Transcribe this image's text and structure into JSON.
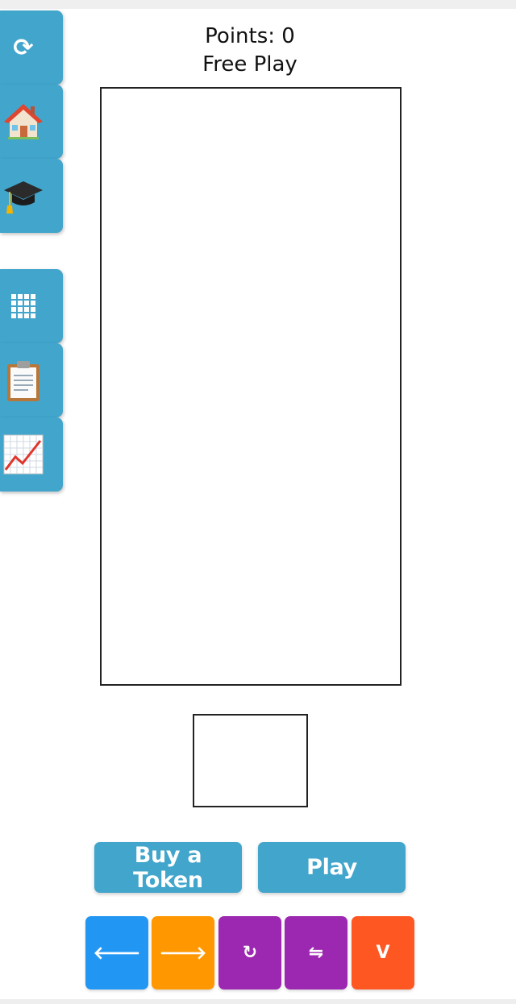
{
  "header": {
    "points_label": "Points: 0",
    "mode_label": "Free Play"
  },
  "sidebar": {
    "items": [
      {
        "name": "refresh",
        "icon": "refresh-icon",
        "glyph": "⟳"
      },
      {
        "name": "home",
        "icon": "house-icon"
      },
      {
        "name": "tutorial",
        "icon": "graduation-cap-icon"
      },
      {
        "name": "grid",
        "icon": "grid-icon"
      },
      {
        "name": "clipboard",
        "icon": "clipboard-icon"
      },
      {
        "name": "chart",
        "icon": "chart-increasing-icon"
      }
    ],
    "color": "#41a5cc"
  },
  "actions": {
    "buy_token_label": "Buy a Token",
    "play_label": "Play"
  },
  "controls": [
    {
      "name": "move-left",
      "glyph": "🡐",
      "color": "#2196f3"
    },
    {
      "name": "move-right",
      "glyph": "🡒",
      "color": "#ff9800"
    },
    {
      "name": "rotate",
      "glyph": "↻",
      "color": "#9c27b0"
    },
    {
      "name": "flip",
      "glyph": "⇋",
      "color": "#9c27b0"
    },
    {
      "name": "drop",
      "glyph": "V",
      "color": "#ff5722"
    }
  ]
}
